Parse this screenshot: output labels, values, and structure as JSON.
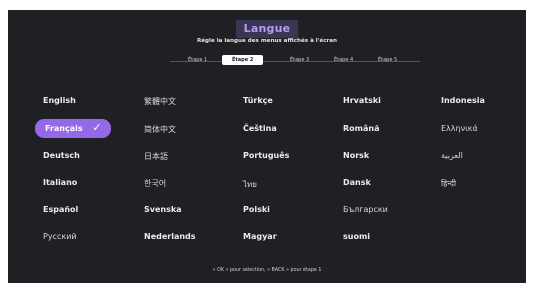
{
  "header": {
    "title": "Langue",
    "subtitle": "Régle la langue des menus affichés à l'écran"
  },
  "steps": [
    {
      "label": "Étape 1",
      "active": false
    },
    {
      "label": "Étape 2",
      "active": true
    },
    {
      "label": "Étape 3",
      "active": false
    },
    {
      "label": "Étape 4",
      "active": false
    },
    {
      "label": "Étape 5",
      "active": false
    }
  ],
  "languages": {
    "col1": [
      "English",
      "Français",
      "Deutsch",
      "Italiano",
      "Español",
      "Pусский"
    ],
    "col2": [
      "繁體中文",
      "简体中文",
      "日本語",
      "한국어",
      "Svenska",
      "Nederlands"
    ],
    "col3": [
      "Türkçe",
      "Čeština",
      "Português",
      "ไทย",
      "Polski",
      "Magyar"
    ],
    "col4": [
      "Hrvatski",
      "Română",
      "Norsk",
      "Dansk",
      "Български",
      "suomi"
    ],
    "col5": [
      "Indonesia",
      "Ελληνικά",
      "العربية",
      "हिन्दी"
    ]
  },
  "selected_language": "Français",
  "footer": {
    "hint": "« OK » pour sélection, « BACK » pour étape 1"
  },
  "colors": {
    "background": "#1f2024",
    "accent": "#9468e8",
    "title_text": "#b79cf4"
  }
}
